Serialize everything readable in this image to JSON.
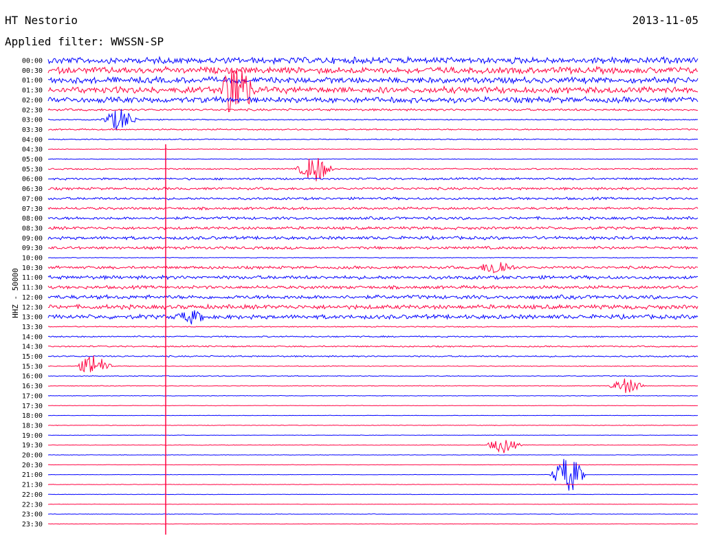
{
  "header": {
    "station": "HT Nestorio",
    "date": "2013-11-05",
    "filter": "Applied filter: WWSSN-SP",
    "channel": "HHZ - 50000"
  },
  "colors": {
    "even_row": "#0000ff",
    "odd_row": "#ff0040",
    "marker": "#ff0040"
  },
  "chart_data": {
    "type": "line",
    "title": "HT Nestorio",
    "subtitle": "Applied filter: WWSSN-SP",
    "ylabel": "HHZ - 50000",
    "row_labels": [
      "00:00",
      "00:30",
      "01:00",
      "01:30",
      "02:00",
      "02:30",
      "03:00",
      "03:30",
      "04:00",
      "04:30",
      "05:00",
      "05:30",
      "06:00",
      "06:30",
      "07:00",
      "07:30",
      "08:00",
      "08:30",
      "09:00",
      "09:30",
      "10:00",
      "10:30",
      "11:00",
      "11:30",
      "12:00",
      "12:30",
      "13:00",
      "13:30",
      "14:00",
      "14:30",
      "15:00",
      "15:30",
      "16:00",
      "16:30",
      "17:00",
      "17:30",
      "18:00",
      "18:30",
      "19:00",
      "19:30",
      "20:00",
      "20:30",
      "21:00",
      "21:30",
      "22:00",
      "22:30",
      "23:00",
      "23:30"
    ],
    "row_noise_level": [
      0.9,
      0.9,
      0.85,
      0.9,
      0.8,
      0.3,
      0.15,
      0.2,
      0.15,
      0.1,
      0.1,
      0.2,
      0.3,
      0.35,
      0.35,
      0.35,
      0.4,
      0.4,
      0.45,
      0.4,
      0.1,
      0.4,
      0.5,
      0.45,
      0.55,
      0.6,
      0.6,
      0.15,
      0.2,
      0.2,
      0.2,
      0.1,
      0.12,
      0.1,
      0.08,
      0.06,
      0.06,
      0.08,
      0.06,
      0.08,
      0.06,
      0.06,
      0.06,
      0.06,
      0.06,
      0.06,
      0.06,
      0.06
    ],
    "events": [
      {
        "row": 3,
        "x": 0.29,
        "amp": 4.0
      },
      {
        "row": 6,
        "x": 0.11,
        "amp": 1.5
      },
      {
        "row": 11,
        "x": 0.41,
        "amp": 1.8
      },
      {
        "row": 21,
        "x": 0.69,
        "amp": 1.0
      },
      {
        "row": 26,
        "x": 0.22,
        "amp": 0.7
      },
      {
        "row": 31,
        "x": 0.07,
        "amp": 1.5
      },
      {
        "row": 33,
        "x": 0.89,
        "amp": 1.0
      },
      {
        "row": 39,
        "x": 0.7,
        "amp": 1.0
      },
      {
        "row": 42,
        "x": 0.8,
        "amp": 2.5
      }
    ]
  }
}
